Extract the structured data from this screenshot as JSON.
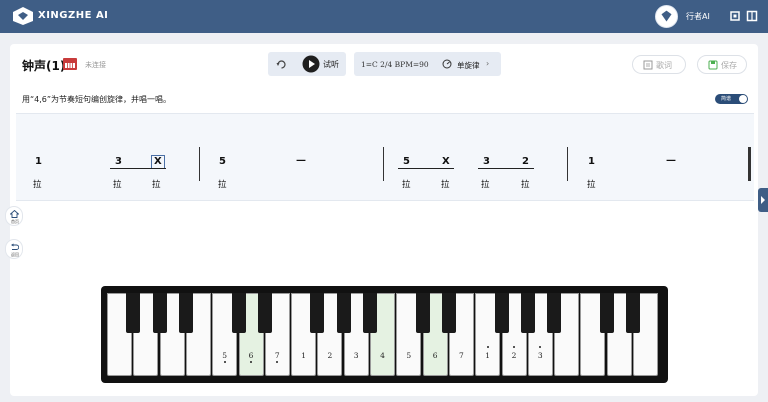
{
  "app": {
    "title": "XINGZHE AI",
    "user_name": "行者AI"
  },
  "song": {
    "title": "钟声(1)",
    "connection_status": "未连接"
  },
  "controls": {
    "listen_label": "试听",
    "key_signature": "1=C  2/4  BPM=90",
    "mode_label": "单旋律",
    "lyrics_label": "歌词",
    "save_label": "保存"
  },
  "instruction": "用“4,6”为节奏短句编创旋律，并唱一唱。",
  "toggle_label": "简谱",
  "score": {
    "notes": [
      "1",
      "3",
      "X",
      "5",
      "—",
      "5",
      "X",
      "3",
      "2",
      "1",
      "—"
    ],
    "lyrics": [
      "拉",
      "拉",
      "拉",
      "拉",
      "拉",
      "拉",
      "拉",
      "拉",
      "拉"
    ]
  },
  "sidebar": {
    "home_label": "首页",
    "back_label": "返回"
  },
  "piano": {
    "key_labels": [
      "5",
      "6",
      "7",
      "1",
      "2",
      "3",
      "4",
      "5",
      "6",
      "7",
      "1",
      "2",
      "3"
    ],
    "highlighted_labels": [
      "6",
      "4",
      "6"
    ]
  },
  "colors": {
    "topbar": "#3f5e86",
    "accent": "#2b4d78",
    "highlight": "#e5f2e2"
  },
  "icons": [
    "logo-icon",
    "sync-icon",
    "grid-icon",
    "loop-icon",
    "play-icon",
    "mode-icon",
    "lyrics-icon",
    "save-icon",
    "home-icon",
    "back-icon",
    "device-icon"
  ]
}
